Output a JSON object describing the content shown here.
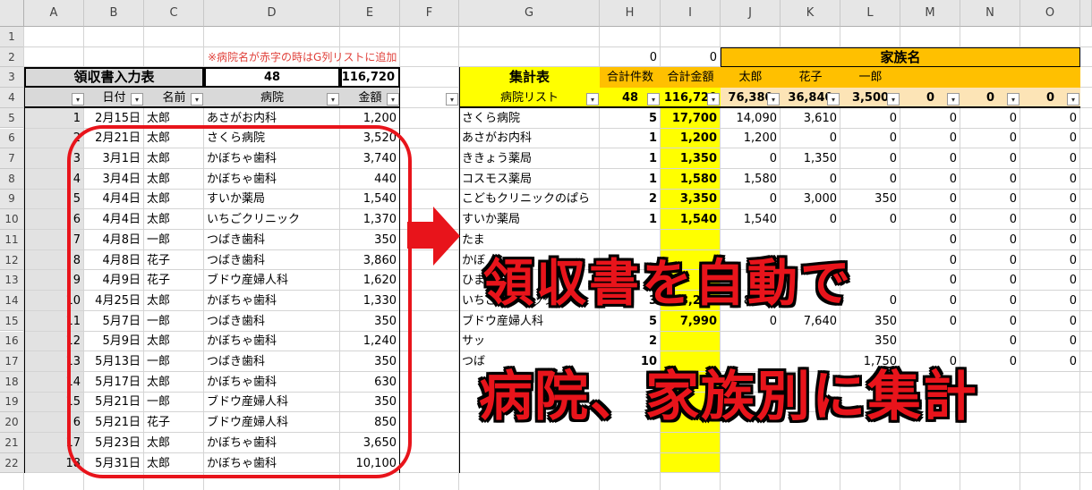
{
  "column_headers": [
    "A",
    "B",
    "C",
    "D",
    "E",
    "F",
    "G",
    "H",
    "I",
    "J",
    "K",
    "L",
    "M",
    "N",
    "O"
  ],
  "row_numbers": [
    "1",
    "2",
    "3",
    "4",
    "5",
    "6",
    "7",
    "8",
    "9",
    "10",
    "11",
    "12",
    "13",
    "14",
    "15",
    "16",
    "17",
    "18",
    "19",
    "20",
    "21",
    "22"
  ],
  "note": "※病院名が赤字の時はG列リストに追加",
  "top_counts": {
    "h2": "0",
    "i2": "0"
  },
  "family_header": "家族名",
  "input_table": {
    "title": "領収書入力表",
    "count": "48",
    "total": "116,720",
    "headers": {
      "date": "日付",
      "name": "名前",
      "hospital": "病院",
      "amount": "金額"
    },
    "rows": [
      {
        "no": "1",
        "date": "2月15日",
        "name": "太郎",
        "hospital": "あさがお内科",
        "amount": "1,200"
      },
      {
        "no": "2",
        "date": "2月21日",
        "name": "太郎",
        "hospital": "さくら病院",
        "amount": "3,520"
      },
      {
        "no": "3",
        "date": "3月1日",
        "name": "太郎",
        "hospital": "かぼちゃ歯科",
        "amount": "3,740"
      },
      {
        "no": "4",
        "date": "3月4日",
        "name": "太郎",
        "hospital": "かぼちゃ歯科",
        "amount": "440"
      },
      {
        "no": "5",
        "date": "4月4日",
        "name": "太郎",
        "hospital": "すいか薬局",
        "amount": "1,540"
      },
      {
        "no": "6",
        "date": "4月4日",
        "name": "太郎",
        "hospital": "いちごクリニック",
        "amount": "1,370"
      },
      {
        "no": "7",
        "date": "4月8日",
        "name": "一郎",
        "hospital": "つばき歯科",
        "amount": "350"
      },
      {
        "no": "8",
        "date": "4月8日",
        "name": "花子",
        "hospital": "つばき歯科",
        "amount": "3,860"
      },
      {
        "no": "9",
        "date": "4月9日",
        "name": "花子",
        "hospital": "ブドウ産婦人科",
        "amount": "1,620"
      },
      {
        "no": "10",
        "date": "4月25日",
        "name": "太郎",
        "hospital": "かぼちゃ歯科",
        "amount": "1,330"
      },
      {
        "no": "11",
        "date": "5月7日",
        "name": "一郎",
        "hospital": "つばき歯科",
        "amount": "350"
      },
      {
        "no": "12",
        "date": "5月9日",
        "name": "太郎",
        "hospital": "かぼちゃ歯科",
        "amount": "1,240"
      },
      {
        "no": "13",
        "date": "5月13日",
        "name": "一郎",
        "hospital": "つばき歯科",
        "amount": "350"
      },
      {
        "no": "14",
        "date": "5月17日",
        "name": "太郎",
        "hospital": "かぼちゃ歯科",
        "amount": "630"
      },
      {
        "no": "15",
        "date": "5月21日",
        "name": "一郎",
        "hospital": "ブドウ産婦人科",
        "amount": "350"
      },
      {
        "no": "6",
        "date": "5月21日",
        "name": "花子",
        "hospital": "ブドウ産婦人科",
        "amount": "850"
      },
      {
        "no": "17",
        "date": "5月23日",
        "name": "太郎",
        "hospital": "かぼちゃ歯科",
        "amount": "3,650"
      },
      {
        "no": "18",
        "date": "5月31日",
        "name": "太郎",
        "hospital": "かぼちゃ歯科",
        "amount": "10,100"
      }
    ]
  },
  "summary_table": {
    "title": "集計表",
    "list_label": "病院リスト",
    "count_header": "合計件数",
    "amount_header": "合計金額",
    "family": [
      "太郎",
      "花子",
      "一郎",
      "",
      "",
      ""
    ],
    "total_count": "48",
    "total_amount": "116,720",
    "family_totals": [
      "76,380",
      "36,840",
      "3,500",
      "0",
      "0",
      "0"
    ],
    "rows": [
      {
        "hospital": "さくら病院",
        "count": "5",
        "amount": "17,700",
        "f": [
          "14,090",
          "3,610",
          "0",
          "0",
          "0",
          "0"
        ]
      },
      {
        "hospital": "あさがお内科",
        "count": "1",
        "amount": "1,200",
        "f": [
          "1,200",
          "0",
          "0",
          "0",
          "0",
          "0"
        ]
      },
      {
        "hospital": "ききょう薬局",
        "count": "1",
        "amount": "1,350",
        "f": [
          "0",
          "1,350",
          "0",
          "0",
          "0",
          "0"
        ]
      },
      {
        "hospital": "コスモス薬局",
        "count": "1",
        "amount": "1,580",
        "f": [
          "1,580",
          "0",
          "0",
          "0",
          "0",
          "0"
        ]
      },
      {
        "hospital": "こどもクリニックのぱら",
        "count": "2",
        "amount": "3,350",
        "f": [
          "0",
          "3,000",
          "350",
          "0",
          "0",
          "0"
        ]
      },
      {
        "hospital": "すいか薬局",
        "count": "1",
        "amount": "1,540",
        "f": [
          "1,540",
          "0",
          "0",
          "0",
          "0",
          "0"
        ]
      },
      {
        "hospital": "たま",
        "count": "",
        "amount": "",
        "f": [
          "",
          "",
          "",
          "0",
          "0",
          "0"
        ]
      },
      {
        "hospital": "かぼ",
        "count": "",
        "amount": "",
        "f": [
          "",
          "",
          "",
          "0",
          "0",
          "0"
        ]
      },
      {
        "hospital": "ひま",
        "count": "2",
        "amount": "",
        "f": [
          "",
          "",
          "",
          "0",
          "0",
          "0"
        ]
      },
      {
        "hospital": "いちごクリニック",
        "count": "3",
        "amount": "8,220",
        "f": [
          "8,220",
          "0",
          "0",
          "0",
          "0",
          "0"
        ]
      },
      {
        "hospital": "ブドウ産婦人科",
        "count": "5",
        "amount": "7,990",
        "f": [
          "0",
          "7,640",
          "350",
          "0",
          "0",
          "0"
        ]
      },
      {
        "hospital": "サッ",
        "count": "2",
        "amount": "",
        "f": [
          "",
          "",
          "350",
          "",
          "0",
          "0"
        ]
      },
      {
        "hospital": "つば",
        "count": "10",
        "amount": "",
        "f": [
          "",
          "",
          "1,750",
          "0",
          "0",
          "0"
        ]
      }
    ]
  },
  "overlay": {
    "line1": "領収書を自動で",
    "line2": "病院、家族別に集計"
  },
  "colors": {
    "accent_red": "#e8141b",
    "yellow": "#ffff00",
    "orange": "#ffc000",
    "light_orange": "#fce4b6",
    "gray": "#d9d9d9"
  }
}
